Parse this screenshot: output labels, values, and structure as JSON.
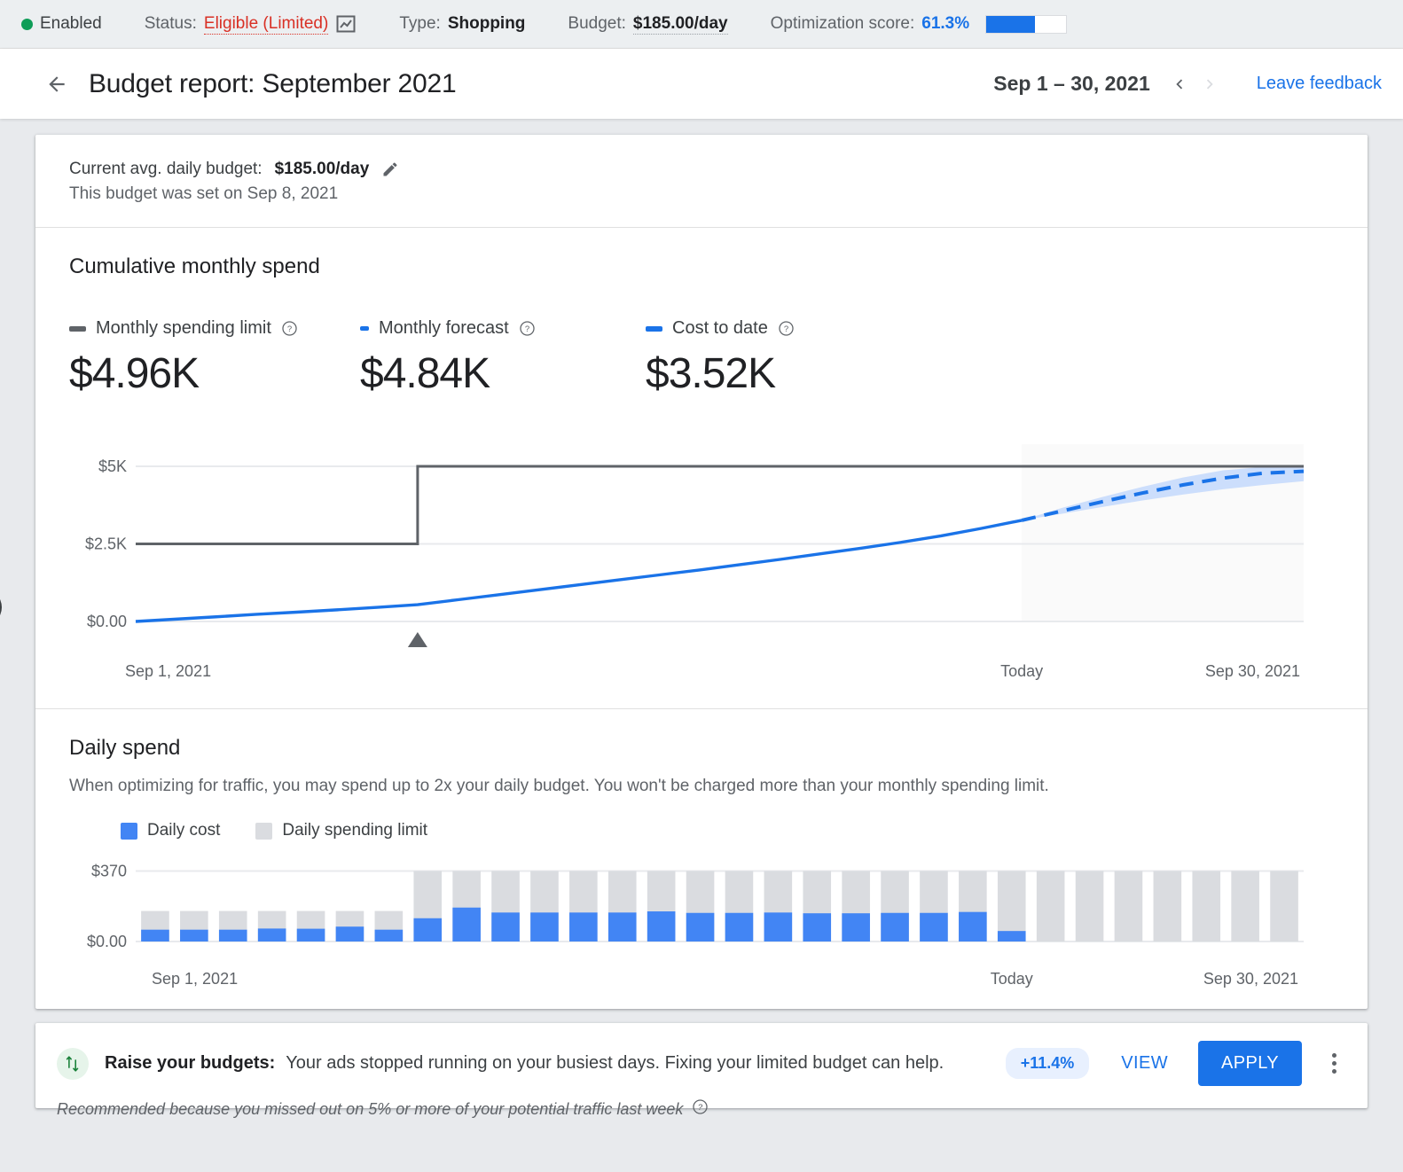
{
  "statusbar": {
    "enabled_label": "Enabled",
    "status_label": "Status:",
    "status_value": "Eligible (Limited)",
    "graph_icon": "chart-icon",
    "type_label": "Type:",
    "type_value": "Shopping",
    "budget_label": "Budget:",
    "budget_value": "$185.00/day",
    "opt_label": "Optimization score:",
    "opt_value": "61.3%",
    "opt_percent": 61.3,
    "enabled_color": "#0f9d58",
    "status_color": "#d93025",
    "accent_color": "#1a73e8"
  },
  "header": {
    "back_icon": "back-arrow-icon",
    "title": "Budget report: September 2021",
    "date_range": "Sep 1 – 30, 2021",
    "prev_icon": "chevron-left-icon",
    "next_icon": "chevron-right-icon",
    "feedback_label": "Leave feedback"
  },
  "budget": {
    "current_label": "Current avg. daily budget:",
    "current_value": "$185.00/day",
    "edit_icon": "pencil-icon",
    "set_on": "This budget was set on Sep 8, 2021"
  },
  "cumulative": {
    "title": "Cumulative monthly spend",
    "metrics": [
      {
        "label": "Monthly spending limit",
        "value": "$4.96K",
        "color": "#5f6368",
        "style": "solid",
        "help_icon": "help-icon"
      },
      {
        "label": "Monthly forecast",
        "value": "$4.84K",
        "color": "#1a73e8",
        "style": "dashed",
        "help_icon": "help-icon"
      },
      {
        "label": "Cost to date",
        "value": "$3.52K",
        "color": "#1a73e8",
        "style": "solid",
        "help_icon": "help-icon"
      }
    ]
  },
  "daily": {
    "title": "Daily spend",
    "description": "When optimizing for traffic, you may spend up to 2x your daily budget. You won't be charged more than your monthly spending limit.",
    "legend": [
      {
        "label": "Daily cost",
        "color": "#4285f4"
      },
      {
        "label": "Daily spending limit",
        "color": "#dadce0"
      }
    ]
  },
  "recommendation": {
    "icon": "swap-vertical-icon",
    "title": "Raise your budgets:",
    "text": "Your ads stopped running on your busiest days. Fixing your limited budget can help.",
    "pill": "+11.4%",
    "view_label": "VIEW",
    "apply_label": "APPLY",
    "menu_icon": "kebab-menu-icon",
    "subtext": "Recommended because you missed out on 5% or more of your potential traffic last week",
    "sub_help_icon": "help-icon"
  },
  "collapse_handle": {
    "icon": "chevron-right-icon"
  },
  "chart_data": [
    {
      "type": "line",
      "name": "cumulative-monthly-spend",
      "title": "Cumulative monthly spend",
      "xlabel": "",
      "ylabel": "",
      "ylim": [
        0,
        5600
      ],
      "yticks": [
        0,
        2500,
        5000
      ],
      "ytick_labels": [
        "$0.00",
        "$2.5K",
        "$5K"
      ],
      "x_tick_labels": [
        "Sep 1, 2021",
        "Today",
        "Sep 30, 2021"
      ],
      "x_tick_days": [
        1,
        23,
        30
      ],
      "grid": true,
      "today_day": 23,
      "budget_change_day": 8,
      "budget_change_marker": "triangle-up-marker",
      "series": [
        {
          "name": "Monthly spending limit",
          "type": "step",
          "color": "#5f6368",
          "values": [
            {
              "day": 1,
              "value": 2500
            },
            {
              "day": 8,
              "value": 2500
            },
            {
              "day": 8,
              "value": 5000
            },
            {
              "day": 30,
              "value": 5000
            }
          ]
        },
        {
          "name": "Cost to date",
          "type": "line",
          "color": "#1a73e8",
          "x": [
            1,
            2,
            3,
            4,
            5,
            6,
            7,
            8,
            9,
            10,
            11,
            12,
            13,
            14,
            15,
            16,
            17,
            18,
            19,
            20,
            21,
            22,
            23
          ],
          "values": [
            0,
            75,
            150,
            230,
            300,
            375,
            455,
            540,
            700,
            860,
            1020,
            1180,
            1340,
            1500,
            1660,
            1830,
            2000,
            2180,
            2360,
            2550,
            2760,
            3000,
            3260
          ]
        },
        {
          "name": "Monthly forecast",
          "type": "dashed-line",
          "color": "#1a73e8",
          "x": [
            23,
            24,
            25,
            26,
            27,
            28,
            29,
            30
          ],
          "values": [
            3260,
            3560,
            3860,
            4140,
            4400,
            4620,
            4780,
            4840
          ]
        },
        {
          "name": "Forecast range",
          "type": "band",
          "color": "#aecbfa",
          "x": [
            23,
            24,
            25,
            26,
            27,
            28,
            29,
            30
          ],
          "upper": [
            3260,
            3660,
            4010,
            4340,
            4640,
            4870,
            4980,
            5000
          ],
          "lower": [
            3260,
            3470,
            3690,
            3900,
            4090,
            4260,
            4400,
            4520
          ]
        }
      ]
    },
    {
      "type": "bar",
      "name": "daily-spend",
      "title": "Daily spend",
      "ylim": [
        0,
        400
      ],
      "yticks": [
        0,
        370
      ],
      "ytick_labels": [
        "$0.00",
        "$370"
      ],
      "x_tick_labels": [
        "Sep 1, 2021",
        "Today",
        "Sep 30, 2021"
      ],
      "x_tick_days": [
        1,
        23,
        30
      ],
      "categories": [
        1,
        2,
        3,
        4,
        5,
        6,
        7,
        8,
        9,
        10,
        11,
        12,
        13,
        14,
        15,
        16,
        17,
        18,
        19,
        20,
        21,
        22,
        23,
        24,
        25,
        26,
        27,
        28,
        29,
        30
      ],
      "today_day": 23,
      "series": [
        {
          "name": "Daily spending limit",
          "color": "#dadce0",
          "values": [
            160,
            160,
            160,
            160,
            160,
            160,
            160,
            370,
            370,
            370,
            370,
            370,
            370,
            370,
            370,
            370,
            370,
            370,
            370,
            370,
            370,
            370,
            370,
            370,
            370,
            370,
            370,
            370,
            370,
            370
          ]
        },
        {
          "name": "Daily cost",
          "color": "#4285f4",
          "values": [
            62,
            62,
            62,
            68,
            67,
            78,
            62,
            122,
            178,
            152,
            152,
            152,
            152,
            158,
            150,
            150,
            152,
            148,
            148,
            150,
            150,
            155,
            55,
            0,
            0,
            0,
            0,
            0,
            0,
            0
          ]
        }
      ]
    }
  ]
}
